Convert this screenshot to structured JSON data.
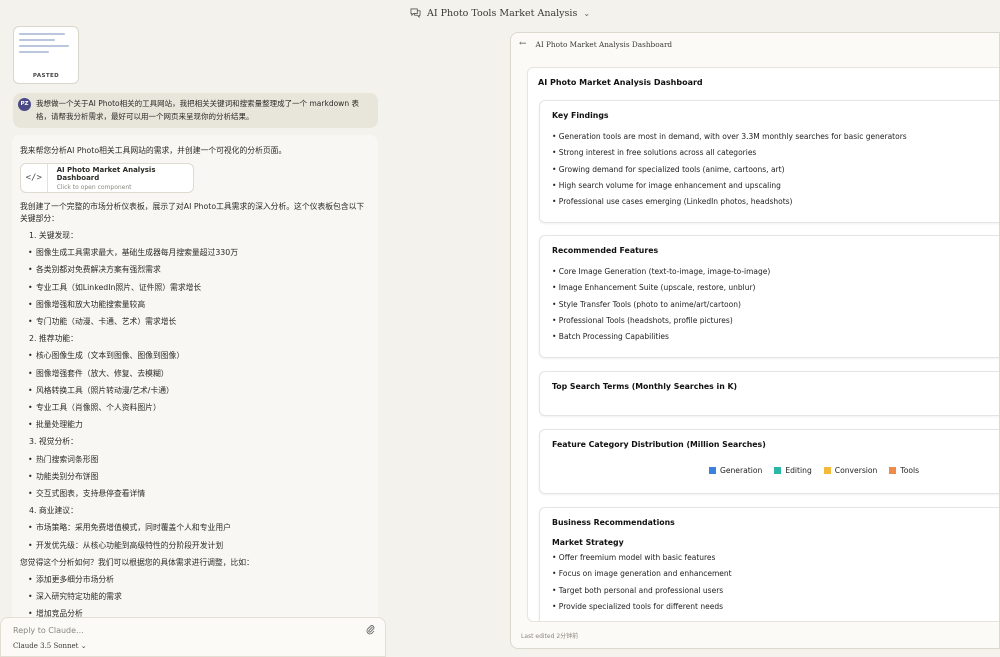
{
  "topbar": {
    "title": "AI Photo Tools Market Analysis"
  },
  "pasted": {
    "label": "PASTED"
  },
  "user_message": {
    "avatar": "PZ",
    "text": "我想做一个关于AI Photo相关的工具网站，我把相关关键词和搜索量整理成了一个 markdown 表格，请帮我分析需求，最好可以用一个网页来呈现你的分析结果。"
  },
  "reply": {
    "intro": "我来帮您分析AI Photo相关工具网站的需求，并创建一个可视化的分析页面。",
    "artifact": {
      "title": "AI Photo Market Analysis Dashboard",
      "subtitle": "Click to open component"
    },
    "summary": "我创建了一个完整的市场分析仪表板，展示了对AI Photo工具需求的深入分析。这个仪表板包含以下关键部分：",
    "sections": [
      {
        "heading": "1. 关键发现：",
        "bullets": [
          "图像生成工具需求最大，基础生成器每月搜索量超过330万",
          "各类别都对免费解决方案有强烈需求",
          "专业工具（如LinkedIn照片、证件照）需求增长",
          "图像增强和放大功能搜索量较高",
          "专门功能（动漫、卡通、艺术）需求增长"
        ]
      },
      {
        "heading": "2. 推荐功能：",
        "bullets": [
          "核心图像生成（文本到图像、图像到图像）",
          "图像增强套件（放大、修复、去模糊）",
          "风格转换工具（照片转动漫/艺术/卡通）",
          "专业工具（肖像照、个人资料图片）",
          "批量处理能力"
        ]
      },
      {
        "heading": "3. 视觉分析：",
        "bullets": [
          "热门搜索词条形图",
          "功能类别分布饼图",
          "交互式图表，支持悬停查看详情"
        ]
      },
      {
        "heading": "4. 商业建议：",
        "bullets": [
          "市场策略：采用免费增值模式，同时覆盖个人和专业用户",
          "开发优先级：从核心功能到高级特性的分阶段开发计划"
        ]
      }
    ],
    "closing": "您觉得这个分析如何？我们可以根据您的具体需求进行调整，比如：",
    "closing_bullets": [
      "添加更多细分市场分析",
      "深入研究特定功能的需求",
      "增加竞品分析"
    ]
  },
  "input": {
    "placeholder": "Reply to Claude...",
    "model": "Claude 3.5 Sonnet"
  },
  "panel": {
    "header_title": "AI Photo Market Analysis Dashboard",
    "dashboard_title": "AI Photo Market Analysis Dashboard",
    "key_findings": {
      "title": "Key Findings",
      "items": [
        "• Generation tools are most in demand, with over 3.3M monthly searches for basic generators",
        "• Strong interest in free solutions across all categories",
        "• Growing demand for specialized tools (anime, cartoons, art)",
        "• High search volume for image enhancement and upscaling",
        "• Professional use cases emerging (LinkedIn photos, headshots)"
      ]
    },
    "recommended": {
      "title": "Recommended Features",
      "items": [
        "• Core Image Generation (text-to-image, image-to-image)",
        "• Image Enhancement Suite (upscale, restore, unblur)",
        "• Style Transfer Tools (photo to anime/art/cartoon)",
        "• Professional Tools (headshots, profile pictures)",
        "• Batch Processing Capabilities"
      ]
    },
    "top_search": {
      "title": "Top Search Terms (Monthly Searches in K)"
    },
    "distribution": {
      "title": "Feature Category Distribution (Million Searches)",
      "legend": [
        {
          "label": "Generation",
          "color": "#3b82e0"
        },
        {
          "label": "Editing",
          "color": "#2bb7a8"
        },
        {
          "label": "Conversion",
          "color": "#f2b93b"
        },
        {
          "label": "Tools",
          "color": "#ee8a4a"
        }
      ]
    },
    "business": {
      "title": "Business Recommendations",
      "subtitle": "Market Strategy",
      "items": [
        "• Offer freemium model with basic features",
        "• Focus on image generation and enhancement",
        "• Target both personal and professional users",
        "• Provide specialized tools for different needs"
      ]
    },
    "footer": "Last edited 2分钟前"
  }
}
